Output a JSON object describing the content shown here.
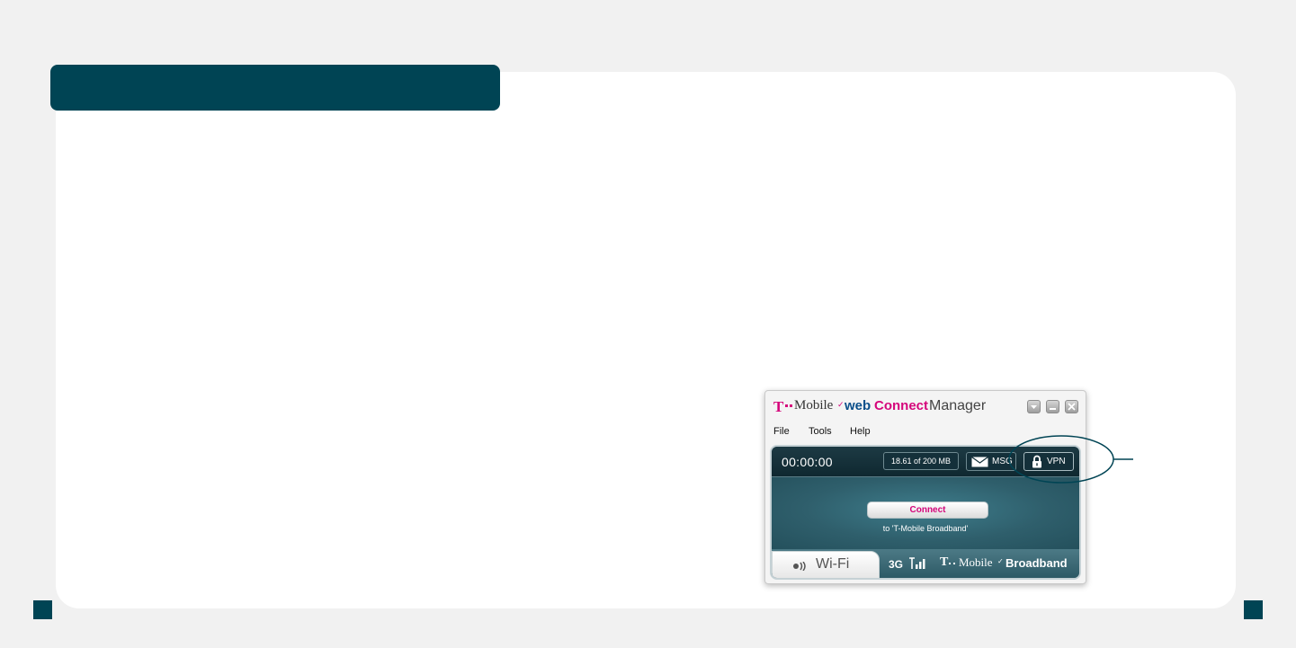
{
  "app": {
    "brand": {
      "t_logo": "T",
      "mobile": "Mobile",
      "web": "web",
      "connect": "Connect",
      "manager": "Manager"
    },
    "window_buttons": [
      "dropdown-icon",
      "minimize-icon",
      "close-icon"
    ]
  },
  "menu": {
    "file": "File",
    "tools": "Tools",
    "help": "Help"
  },
  "status": {
    "timer": "00:00:00",
    "usage": "18.61 of 200 MB",
    "msg_label": "MSG",
    "vpn_label": "VPN"
  },
  "main": {
    "connect_label": "Connect",
    "connect_sub": "to 'T-Mobile Broadband'"
  },
  "tabs": {
    "wifi_label": "Wi-Fi",
    "network_type": "3G",
    "broadband_t": "T",
    "broadband_mobile": "Mobile",
    "broadband_label": "Broadband"
  },
  "colors": {
    "brand_magenta": "#d5067b",
    "header_teal": "#004454",
    "panel_teal": "#3f6a76"
  },
  "icons": [
    "envelope-icon",
    "lock-icon",
    "wifi-icon",
    "signal-bars-icon"
  ]
}
